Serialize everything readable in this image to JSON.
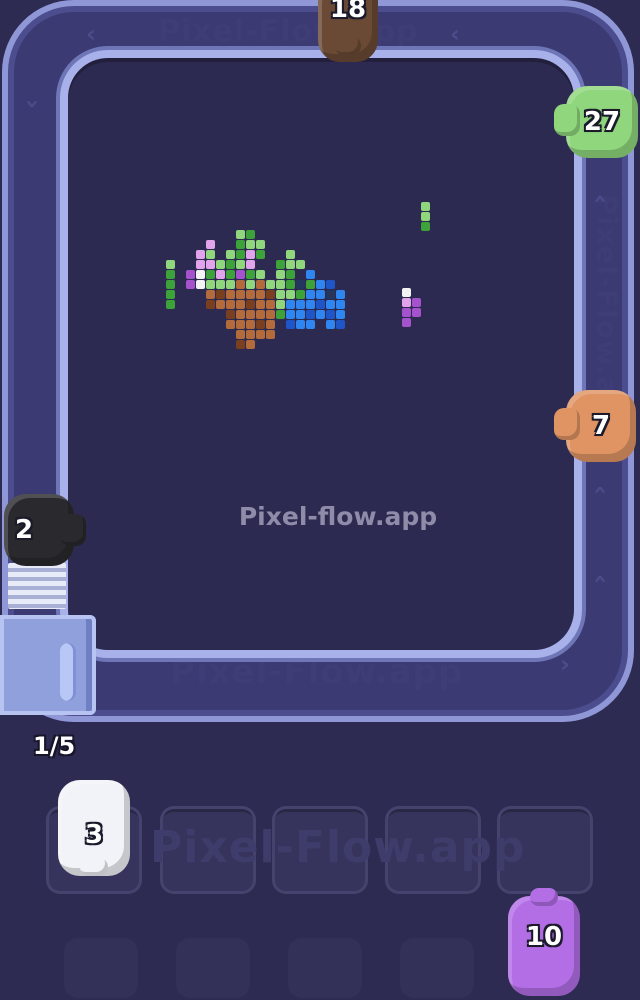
{
  "watermark": "Pixel-flow.app",
  "track_watermarks": [
    "Pixel-Flow.app",
    "Pixel-Flow.app",
    "Pixel-flow.app",
    "Pixel-Flow.app"
  ],
  "slot_watermark": "Pixel-Flow.app",
  "launcher": {
    "capacity_text": "1/5"
  },
  "conveyor_pigs": [
    {
      "id": "top",
      "color": "#6b4a35",
      "count": "18"
    },
    {
      "id": "right1",
      "color": "#8fd67d",
      "count": "27"
    },
    {
      "id": "right2",
      "color": "#e09463",
      "count": "7"
    },
    {
      "id": "left",
      "color": "#2a2a2e",
      "count": "2"
    }
  ],
  "slots": [
    {
      "index": 1,
      "occupant": {
        "color": "#f1f3f8",
        "count": "3"
      }
    },
    {
      "index": 2,
      "occupant": null
    },
    {
      "index": 3,
      "occupant": null
    },
    {
      "index": 4,
      "occupant": null
    },
    {
      "index": 5,
      "occupant": null
    }
  ],
  "queue_pig": {
    "color": "#b36ee6",
    "count": "10"
  },
  "palette": {
    "background": "#2e2b52",
    "track": "#3b3a73",
    "track_rail": "#a8b1ea",
    "pixel_colors": [
      "#8fd67d",
      "#3da23a",
      "#e1a4ea",
      "#a453cc",
      "#f3f3f3",
      "#b36b3c",
      "#7a3f1e",
      "#2f86f0",
      "#1e55c8",
      "#26355e"
    ]
  }
}
